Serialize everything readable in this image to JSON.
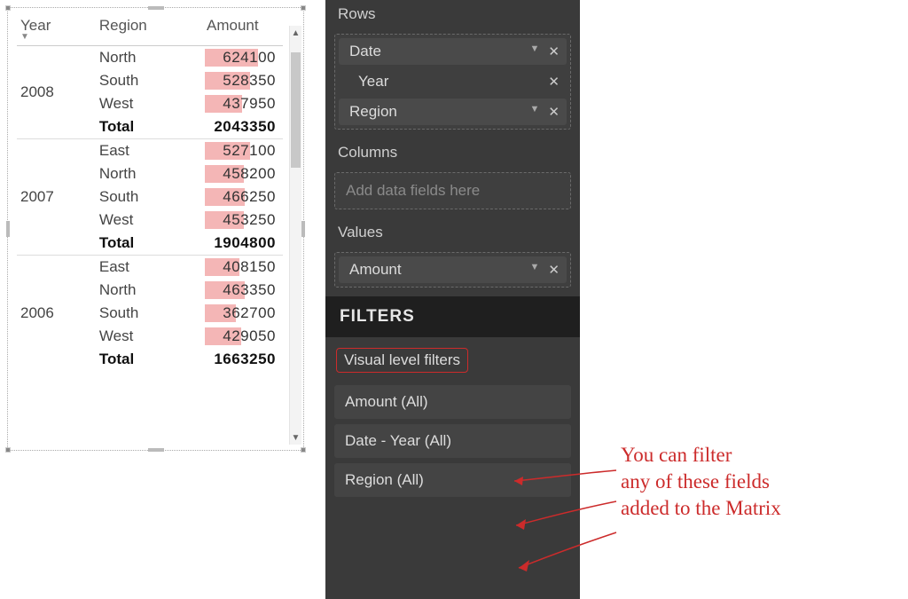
{
  "matrix": {
    "columns": [
      "Year",
      "Region",
      "Amount"
    ],
    "max_amount": 624100,
    "groups": [
      {
        "year": "2008",
        "rows": [
          {
            "region": "North",
            "amount": 624100
          },
          {
            "region": "South",
            "amount": 528350
          },
          {
            "region": "West",
            "amount": 437950
          }
        ],
        "total": 2043350
      },
      {
        "year": "2007",
        "rows": [
          {
            "region": "East",
            "amount": 527100
          },
          {
            "region": "North",
            "amount": 458200
          },
          {
            "region": "South",
            "amount": 466250
          },
          {
            "region": "West",
            "amount": 453250
          }
        ],
        "total": 1904800
      },
      {
        "year": "2006",
        "rows": [
          {
            "region": "East",
            "amount": 408150
          },
          {
            "region": "North",
            "amount": 463350
          },
          {
            "region": "South",
            "amount": 362700
          },
          {
            "region": "West",
            "amount": 429050
          }
        ],
        "total": 1663250
      }
    ],
    "total_label": "Total"
  },
  "panel": {
    "rows_label": "Rows",
    "columns_label": "Columns",
    "columns_placeholder": "Add data fields here",
    "values_label": "Values",
    "rows_fields": {
      "date": "Date",
      "year": "Year",
      "region": "Region"
    },
    "values_fields": {
      "amount": "Amount"
    },
    "filters_header": "FILTERS",
    "vlf_label": "Visual level filters",
    "filters": [
      {
        "label": "Amount  (All)"
      },
      {
        "label": "Date - Year  (All)"
      },
      {
        "label": "Region  (All)"
      }
    ]
  },
  "annotation": {
    "line1": "You can filter",
    "line2": "any of these fields",
    "line3": "added to the Matrix"
  }
}
